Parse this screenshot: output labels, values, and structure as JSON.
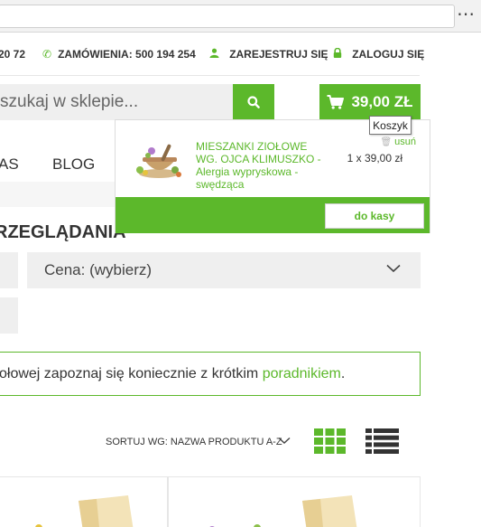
{
  "browser": {
    "menu_icon": "more-dots-icon"
  },
  "topbar": {
    "phone_partial": "20 72",
    "orders_label": "ZAMÓWIENIA: 500 194 254",
    "register_label": "ZAREJESTRUJ SIĘ",
    "login_label": "ZALOGUJ SIĘ",
    "icons": [
      "phone-icon",
      "user-icon",
      "lock-icon"
    ]
  },
  "search": {
    "placeholder": "szukaj w sklepie..."
  },
  "cart": {
    "total": "39,00 ZŁ",
    "tooltip": "Koszyk",
    "item_name": "MIESZANKI ZIOŁOWE WG. OJCA KLIMUSZKO - Alergia wypryskowa - swędząca",
    "item_qty": "1 x 39,00 zł",
    "remove_label": "usuń",
    "checkout_label": "do kasy"
  },
  "nav": {
    "item_partial": "AS",
    "blog": "BLOG"
  },
  "page": {
    "heading": "RZEGLĄDANIA",
    "price_filter": "Cena: (wybierz)",
    "info_text": "ołowej zapoznaj się koniecznie z krótkim ",
    "info_link": "poradnikiem",
    "info_tail": ".",
    "sort_label": "SORTUJ WG: NAZWA PRODUKTU A-Z"
  },
  "colors": {
    "accent": "#5cb82b",
    "field_bg": "#efefef",
    "text": "#333333"
  }
}
